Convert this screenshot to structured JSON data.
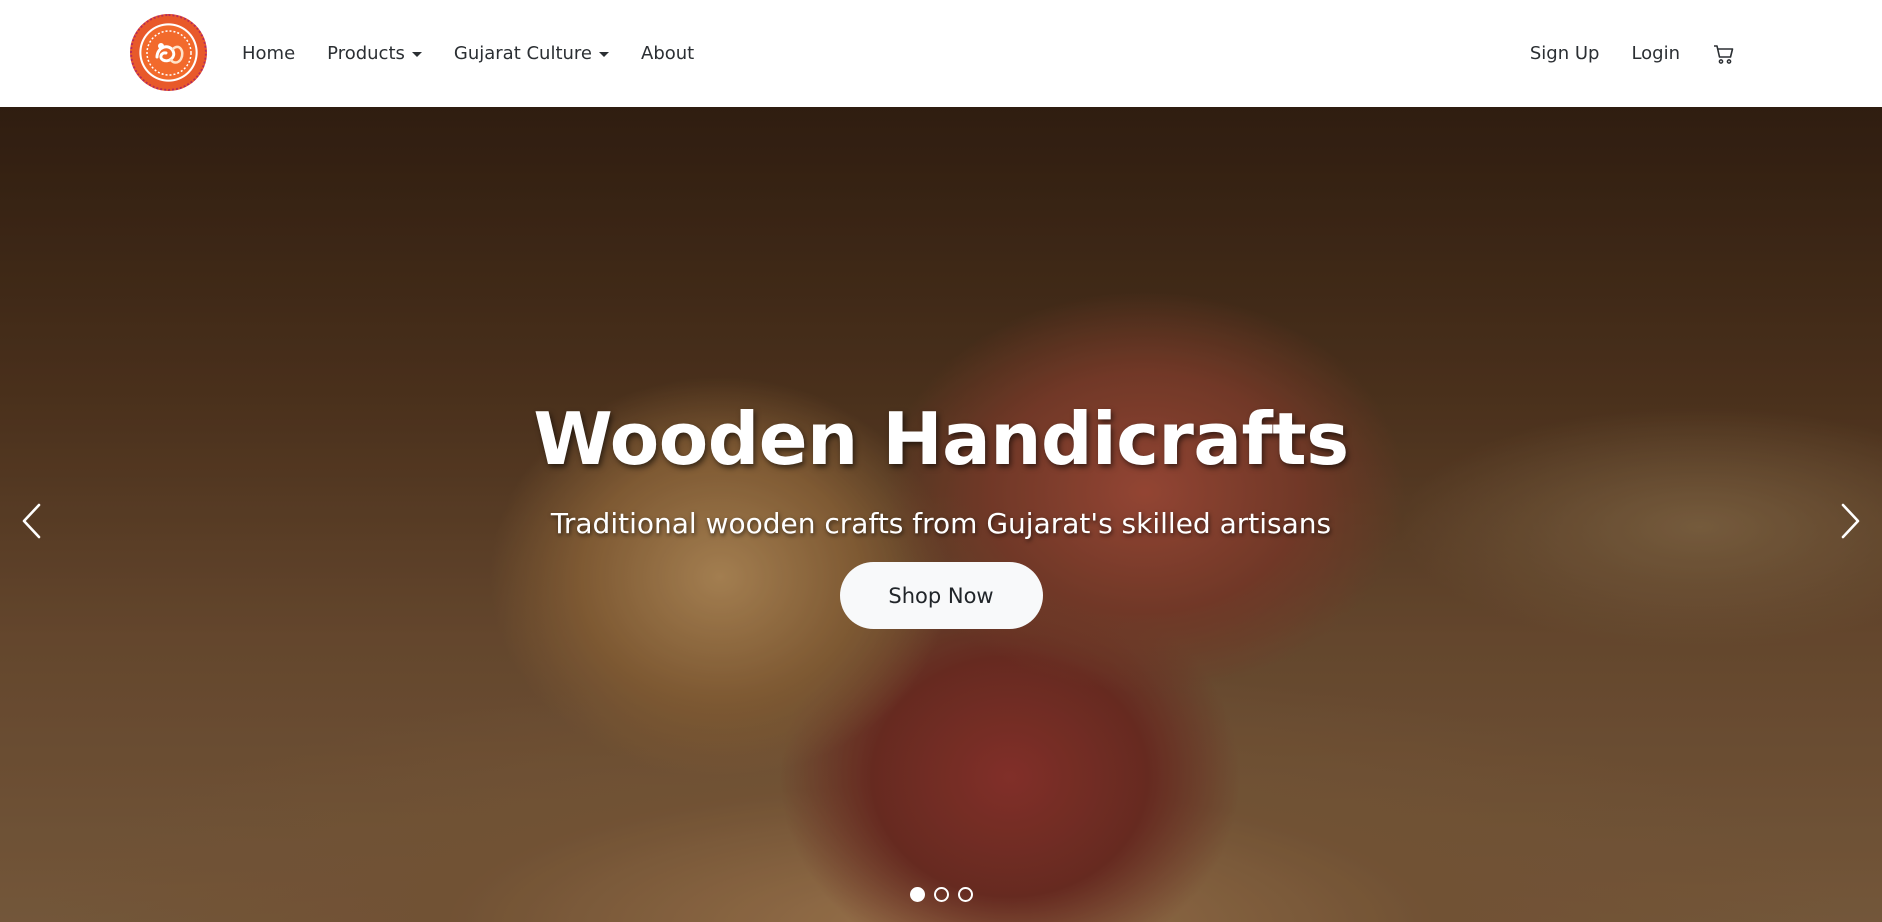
{
  "navbar": {
    "logo_alt": "logo",
    "left_links": [
      {
        "label": "Home"
      },
      {
        "label": "Products"
      },
      {
        "label": "Gujarat Culture"
      },
      {
        "label": "About"
      }
    ],
    "right_links": [
      {
        "label": "Sign Up"
      },
      {
        "label": "Login"
      }
    ],
    "cart_icon": "cart-icon"
  },
  "hero": {
    "title": "Wooden Handicrafts",
    "subtitle": "Traditional wooden crafts from Gujarat's skilled artisans",
    "button_label": "Shop Now",
    "slides_count": 3,
    "active_slide": 1,
    "prev_icon": "chevron-left-icon",
    "next_icon": "chevron-right-icon"
  },
  "colors": {
    "navbar_bg": "#ffffff",
    "nav_text": "#2b2f33",
    "logo_orange": "#f26a2c",
    "button_bg": "#f8f9fa",
    "hero_text": "#ffffff"
  }
}
